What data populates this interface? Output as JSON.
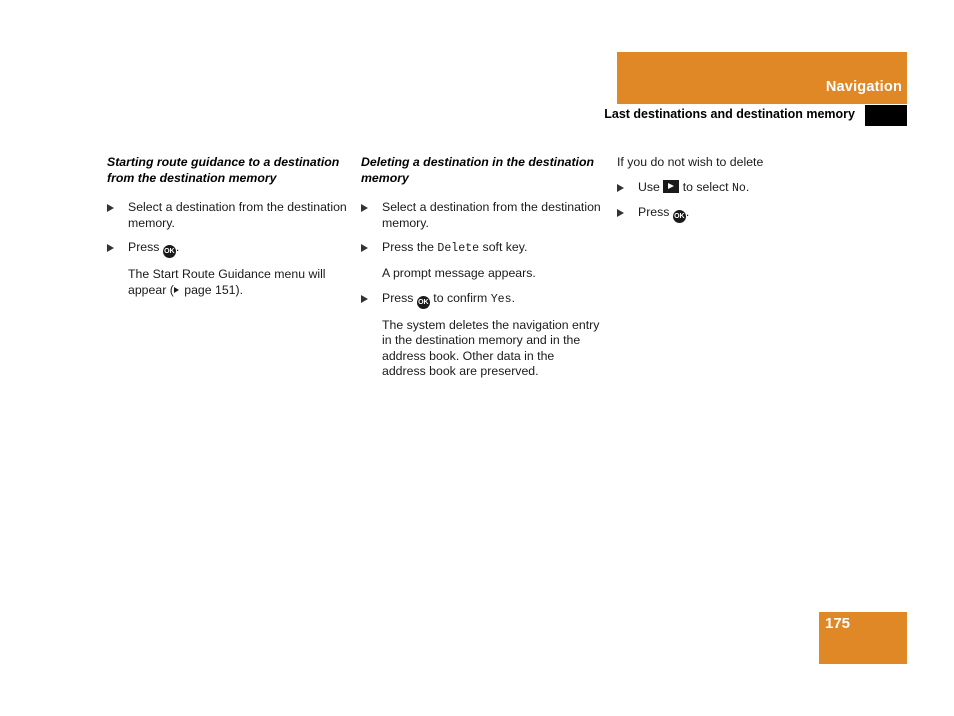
{
  "header": {
    "section_title": "Navigation",
    "subsection_title": "Last destinations and destination memory",
    "accent_color": "#e08726"
  },
  "footer": {
    "page_number": "175"
  },
  "columns": [
    {
      "heading": "Starting route guidance to a destination from the destination memory",
      "blocks": [
        {
          "type": "bullet",
          "parts": [
            {
              "t": "text",
              "v": "Select a destination from the destination memory."
            }
          ]
        },
        {
          "type": "bullet",
          "parts": [
            {
              "t": "text",
              "v": "Press "
            },
            {
              "t": "key",
              "v": "OK"
            },
            {
              "t": "text",
              "v": "."
            }
          ]
        },
        {
          "type": "para",
          "parts": [
            {
              "t": "text",
              "v": "The Start Route Guidance menu will appear ("
            },
            {
              "t": "refarrow",
              "v": ""
            },
            {
              "t": "text",
              "v": " page 151)."
            }
          ]
        }
      ]
    },
    {
      "heading": "Deleting a destination in the destination memory",
      "blocks": [
        {
          "type": "bullet",
          "parts": [
            {
              "t": "text",
              "v": "Select a destination from the destination memory."
            }
          ]
        },
        {
          "type": "bullet",
          "parts": [
            {
              "t": "text",
              "v": "Press the "
            },
            {
              "t": "mono",
              "v": "Delete"
            },
            {
              "t": "text",
              "v": " soft key."
            }
          ]
        },
        {
          "type": "para",
          "parts": [
            {
              "t": "text",
              "v": "A prompt message appears."
            }
          ]
        },
        {
          "type": "bullet",
          "parts": [
            {
              "t": "text",
              "v": "Press "
            },
            {
              "t": "key",
              "v": "OK"
            },
            {
              "t": "text",
              "v": " to confirm "
            },
            {
              "t": "mono",
              "v": "Yes"
            },
            {
              "t": "text",
              "v": "."
            }
          ]
        },
        {
          "type": "para",
          "parts": [
            {
              "t": "text",
              "v": "The system deletes the navigation entry in the destination memory and in the address book. Other data in the address book are preserved."
            }
          ]
        }
      ]
    },
    {
      "heading": "",
      "blocks": [
        {
          "type": "plain",
          "parts": [
            {
              "t": "text",
              "v": "If you do not wish to delete"
            }
          ]
        },
        {
          "type": "bullet",
          "parts": [
            {
              "t": "text",
              "v": "Use "
            },
            {
              "t": "keyright",
              "v": ""
            },
            {
              "t": "text",
              "v": " to select "
            },
            {
              "t": "mono",
              "v": "No"
            },
            {
              "t": "text",
              "v": "."
            }
          ]
        },
        {
          "type": "bullet",
          "parts": [
            {
              "t": "text",
              "v": "Press "
            },
            {
              "t": "key",
              "v": "OK"
            },
            {
              "t": "text",
              "v": "."
            }
          ]
        }
      ]
    }
  ]
}
